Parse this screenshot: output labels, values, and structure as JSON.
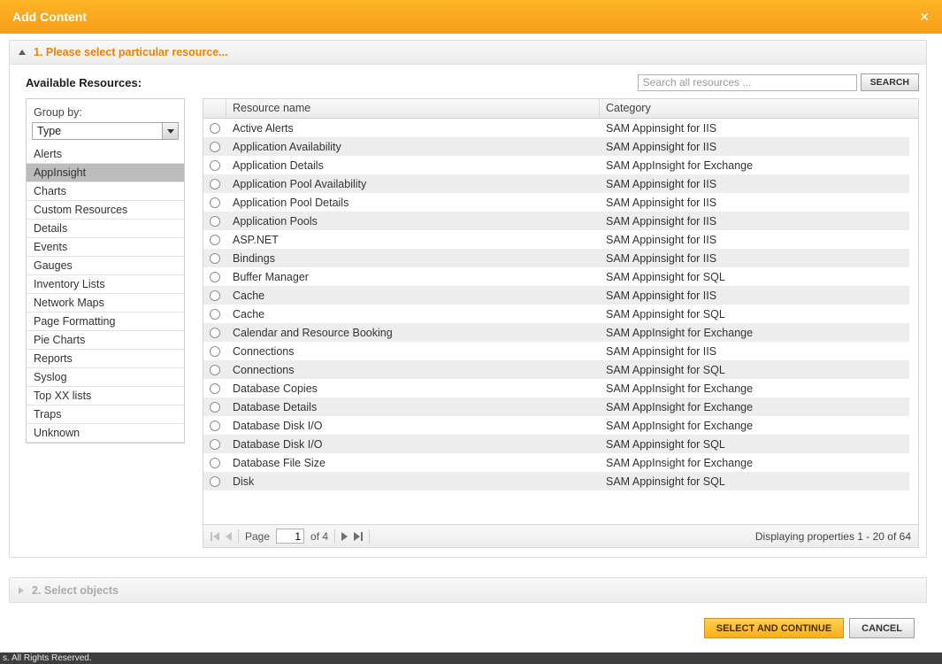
{
  "dialog": {
    "title": "Add Content",
    "close_glyph": "✕"
  },
  "steps": {
    "step1_label": "1. Please select particular resource...",
    "step2_label": "2. Select objects"
  },
  "resources": {
    "label": "Available Resources:",
    "search_placeholder": "Search all resources ...",
    "search_button": "SEARCH"
  },
  "sidebar": {
    "group_by_label": "Group by:",
    "group_by_value": "Type",
    "items": [
      {
        "label": "Alerts",
        "selected": false
      },
      {
        "label": "AppInsight",
        "selected": true
      },
      {
        "label": "Charts",
        "selected": false
      },
      {
        "label": "Custom Resources",
        "selected": false
      },
      {
        "label": "Details",
        "selected": false
      },
      {
        "label": "Events",
        "selected": false
      },
      {
        "label": "Gauges",
        "selected": false
      },
      {
        "label": "Inventory Lists",
        "selected": false
      },
      {
        "label": "Network Maps",
        "selected": false
      },
      {
        "label": "Page Formatting",
        "selected": false
      },
      {
        "label": "Pie Charts",
        "selected": false
      },
      {
        "label": "Reports",
        "selected": false
      },
      {
        "label": "Syslog",
        "selected": false
      },
      {
        "label": "Top XX lists",
        "selected": false
      },
      {
        "label": "Traps",
        "selected": false
      },
      {
        "label": "Unknown",
        "selected": false
      }
    ]
  },
  "table": {
    "columns": [
      "Resource name",
      "Category"
    ],
    "rows": [
      {
        "name": "Active Alerts",
        "category": "SAM Appinsight for IIS"
      },
      {
        "name": "Application Availability",
        "category": "SAM Appinsight for IIS"
      },
      {
        "name": "Application Details",
        "category": "SAM AppInsight for Exchange"
      },
      {
        "name": "Application Pool Availability",
        "category": "SAM Appinsight for IIS"
      },
      {
        "name": "Application Pool Details",
        "category": "SAM Appinsight for IIS"
      },
      {
        "name": "Application Pools",
        "category": "SAM Appinsight for IIS"
      },
      {
        "name": "ASP.NET",
        "category": "SAM Appinsight for IIS"
      },
      {
        "name": "Bindings",
        "category": "SAM Appinsight for IIS"
      },
      {
        "name": "Buffer Manager",
        "category": "SAM Appinsight for SQL"
      },
      {
        "name": "Cache",
        "category": "SAM Appinsight for IIS"
      },
      {
        "name": "Cache",
        "category": "SAM Appinsight for SQL"
      },
      {
        "name": "Calendar and Resource Booking",
        "category": "SAM AppInsight for Exchange"
      },
      {
        "name": "Connections",
        "category": "SAM Appinsight for IIS"
      },
      {
        "name": "Connections",
        "category": "SAM Appinsight for SQL"
      },
      {
        "name": "Database Copies",
        "category": "SAM AppInsight for Exchange"
      },
      {
        "name": "Database Details",
        "category": "SAM AppInsight for Exchange"
      },
      {
        "name": "Database Disk I/O",
        "category": "SAM AppInsight for Exchange"
      },
      {
        "name": "Database Disk I/O",
        "category": "SAM Appinsight for SQL"
      },
      {
        "name": "Database File Size",
        "category": "SAM AppInsight for Exchange"
      },
      {
        "name": "Disk",
        "category": "SAM Appinsight for SQL"
      }
    ]
  },
  "pagination": {
    "page_label": "Page",
    "page_value": "1",
    "of_label": "of 4",
    "status": "Displaying properties 1 - 20 of 64"
  },
  "footer": {
    "select_continue": "SELECT AND CONTINUE",
    "cancel": "CANCEL",
    "copyright_fragment": "s. All Rights Reserved."
  }
}
